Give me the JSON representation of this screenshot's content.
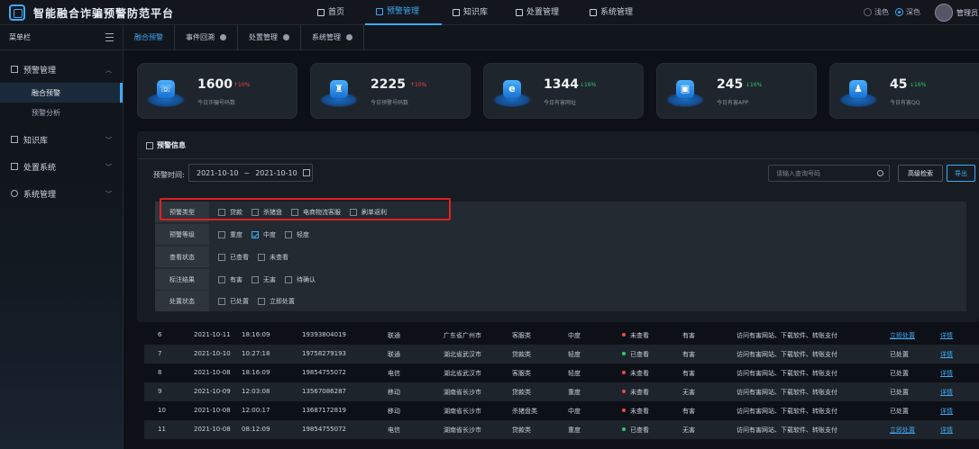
{
  "header": {
    "app_title": "智能融合诈骗预警防范平台",
    "nav": [
      {
        "label": "首页"
      },
      {
        "label": "预警管理"
      },
      {
        "label": "知识库"
      },
      {
        "label": "处置管理"
      },
      {
        "label": "系统管理"
      }
    ],
    "theme_light": "浅色",
    "theme_dark": "深色",
    "user": "管理员"
  },
  "sidebar": {
    "title": "菜单栏",
    "groups": [
      {
        "label": "预警管理",
        "subitems": [
          "融合预警",
          "预警分析"
        ]
      },
      {
        "label": "知识库"
      },
      {
        "label": "处置系统"
      },
      {
        "label": "系统管理"
      }
    ]
  },
  "tabs": [
    "融合预警",
    "事件回溯",
    "处置管理",
    "系统管理"
  ],
  "stats": [
    {
      "value": "1600",
      "delta": "↑10%",
      "label": "今日诈骗号码数",
      "icon": "phone-icon",
      "trend": "up"
    },
    {
      "value": "2225",
      "delta": "↑10%",
      "label": "今日预警号码数",
      "icon": "alarm-icon",
      "trend": "up"
    },
    {
      "value": "1344",
      "delta": "↓16%",
      "label": "今日有害网址",
      "icon": "browser-icon",
      "trend": "down"
    },
    {
      "value": "245",
      "delta": "↓16%",
      "label": "今日有害APP",
      "icon": "app-icon",
      "trend": "down"
    },
    {
      "value": "45",
      "delta": "↓16%",
      "label": "今日有害QQ",
      "icon": "qq-icon",
      "trend": "down"
    }
  ],
  "panel": {
    "title": "预警信息",
    "time_label": "预警时间:",
    "date_start": "2021-10-10",
    "date_sep": "~",
    "date_end": "2021-10-10",
    "search_placeholder": "请输入查询号码",
    "advanced_button": "高级检索",
    "export_button": "导出"
  },
  "filters": [
    {
      "label": "预警类型",
      "options": [
        {
          "text": "贷款",
          "checked": false
        },
        {
          "text": "杀猪盘",
          "checked": false
        },
        {
          "text": "电商物流客服",
          "checked": false
        },
        {
          "text": "刷单返利",
          "checked": false
        }
      ]
    },
    {
      "label": "预警等级",
      "options": [
        {
          "text": "重度",
          "checked": false
        },
        {
          "text": "中度",
          "checked": true
        },
        {
          "text": "轻度",
          "checked": false
        }
      ]
    },
    {
      "label": "查看状态",
      "options": [
        {
          "text": "已查看",
          "checked": false
        },
        {
          "text": "未查看",
          "checked": false
        }
      ]
    },
    {
      "label": "标注结果",
      "options": [
        {
          "text": "有害",
          "checked": false
        },
        {
          "text": "无害",
          "checked": false
        },
        {
          "text": "待确认",
          "checked": false
        }
      ]
    },
    {
      "label": "处置状态",
      "options": [
        {
          "text": "已处置",
          "checked": false
        },
        {
          "text": "立即处置",
          "checked": false
        }
      ]
    }
  ],
  "rows": [
    {
      "id": "6",
      "date": "2021-10-11",
      "time": "18:16:09",
      "phone": "19393804019",
      "carrier": "联通",
      "region": "广东省广州市",
      "type": "客服类",
      "level": "中度",
      "view": "未查看",
      "view_color": "#f04848",
      "mark": "有害",
      "reason": "访问有害网站、下载软件、转账支付",
      "action": "立即处置",
      "action_link": true,
      "detail": "详情"
    },
    {
      "id": "7",
      "date": "2021-10-10",
      "time": "10:27:18",
      "phone": "19758279193",
      "carrier": "联通",
      "region": "湖北省武汉市",
      "type": "贷款类",
      "level": "轻度",
      "view": "已查看",
      "view_color": "#2ecc71",
      "mark": "有害",
      "reason": "访问有害网站、下载软件、转账支付",
      "action": "已处置",
      "action_link": false,
      "detail": "详情"
    },
    {
      "id": "8",
      "date": "2021-10-08",
      "time": "18:16:09",
      "phone": "19854755072",
      "carrier": "电信",
      "region": "湖北省武汉市",
      "type": "客服类",
      "level": "轻度",
      "view": "未查看",
      "view_color": "#f04848",
      "mark": "有害",
      "reason": "访问有害网站、下载软件、转账支付",
      "action": "已处置",
      "action_link": false,
      "detail": "详情"
    },
    {
      "id": "9",
      "date": "2021-10-09",
      "time": "12:03:08",
      "phone": "13567086287",
      "carrier": "移动",
      "region": "湖南省长沙市",
      "type": "贷款类",
      "level": "重度",
      "view": "未查看",
      "view_color": "#f04848",
      "mark": "无害",
      "reason": "访问有害网站、下载软件、转账支付",
      "action": "已处置",
      "action_link": false,
      "detail": "详情"
    },
    {
      "id": "10",
      "date": "2021-10-08",
      "time": "12:00:17",
      "phone": "13687172819",
      "carrier": "移动",
      "region": "湖南省长沙市",
      "type": "杀猪盘类",
      "level": "中度",
      "view": "未查看",
      "view_color": "#f04848",
      "mark": "有害",
      "reason": "访问有害网站、下载软件、转账支付",
      "action": "已处置",
      "action_link": false,
      "detail": "详情"
    },
    {
      "id": "11",
      "date": "2021-10-08",
      "time": "08:12:09",
      "phone": "19854755072",
      "carrier": "电信",
      "region": "湖南省长沙市",
      "type": "贷款类",
      "level": "重度",
      "view": "已查看",
      "view_color": "#2ecc71",
      "mark": "无害",
      "reason": "访问有害网站、下载软件、转账支付",
      "action": "立即处置",
      "action_link": true,
      "detail": "详情"
    }
  ]
}
